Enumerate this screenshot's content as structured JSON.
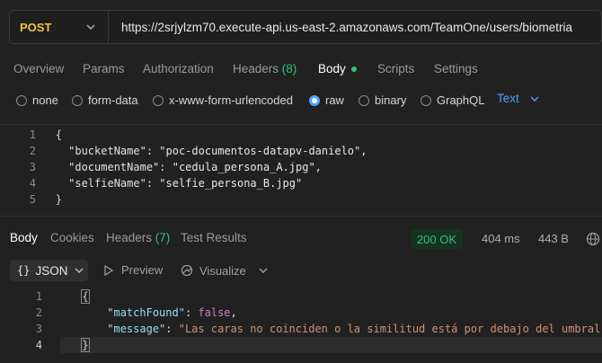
{
  "request": {
    "method": "POST",
    "url": "https://2srjylzm70.execute-api.us-east-2.amazonaws.com/TeamOne/users/biometria"
  },
  "request_tabs": [
    {
      "label": "Overview"
    },
    {
      "label": "Params"
    },
    {
      "label": "Authorization"
    },
    {
      "label": "Headers",
      "count": "(8)"
    },
    {
      "label": "Body"
    },
    {
      "label": "Scripts"
    },
    {
      "label": "Settings"
    }
  ],
  "body_types": [
    {
      "label": "none"
    },
    {
      "label": "form-data"
    },
    {
      "label": "x-www-form-urlencoded"
    },
    {
      "label": "raw",
      "selected": true
    },
    {
      "label": "binary"
    },
    {
      "label": "GraphQL"
    }
  ],
  "body_format": "Text",
  "request_body": {
    "line_numbers": [
      "1",
      "2",
      "3",
      "4",
      "5"
    ],
    "open_brace": "{",
    "close_brace": "}",
    "lines": [
      {
        "key": "\"bucketName\"",
        "value": "\"poc-documentos-datapv-danielo\","
      },
      {
        "key": "\"documentName\"",
        "value": "\"cedula_persona_A.jpg\","
      },
      {
        "key": "\"selfieName\"",
        "value": "\"selfie_persona_B.jpg\""
      }
    ]
  },
  "response_tabs": [
    {
      "label": "Body"
    },
    {
      "label": "Cookies"
    },
    {
      "label": "Headers",
      "count": "(7)"
    },
    {
      "label": "Test Results"
    }
  ],
  "response_status": "200 OK",
  "response_time": "404 ms",
  "response_size": "443 B",
  "response_toolbar": {
    "format": "JSON",
    "preview": "Preview",
    "visualize": "Visualize"
  },
  "response_body": {
    "line_numbers": [
      "1",
      "2",
      "3",
      "4"
    ],
    "open_brace": "{",
    "close_brace": "}",
    "match_key": "\"matchFound\"",
    "match_value": "false",
    "message_key": "\"message\"",
    "message_value": "\"Las caras no coinciden o la similitud está por debajo del umbral.\""
  },
  "colors": {
    "method": "#f5c242",
    "accent": "#4aa3ff",
    "success": "#33c17b"
  }
}
